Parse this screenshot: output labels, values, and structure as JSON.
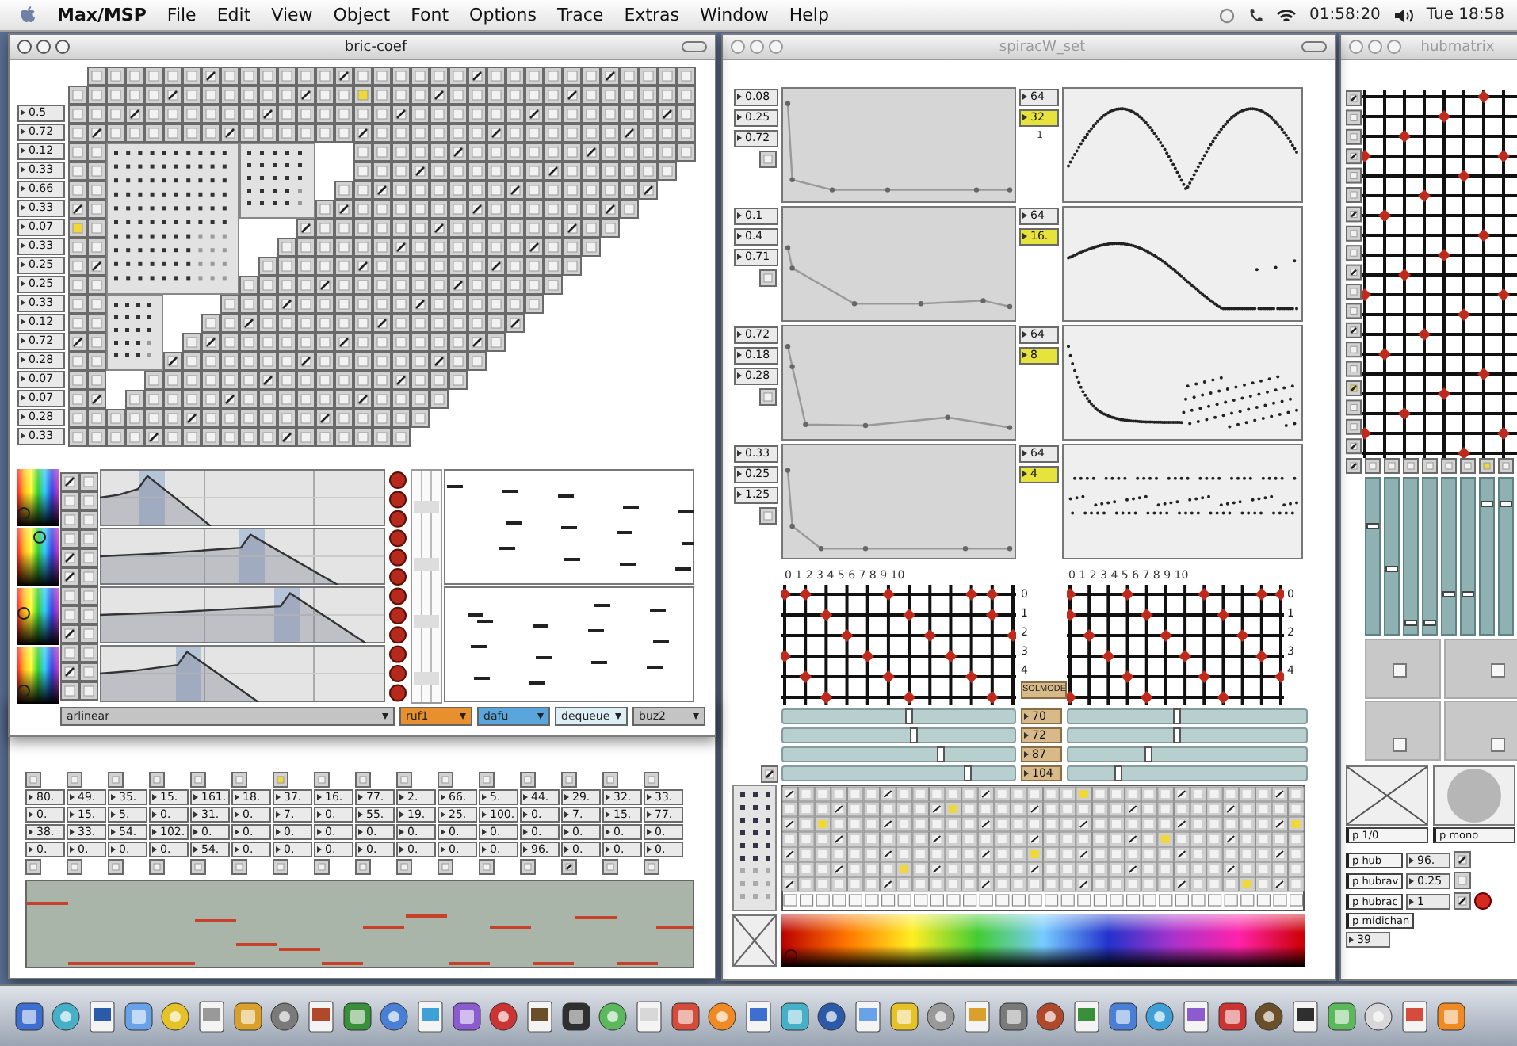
{
  "menubar": {
    "app": "Max/MSP",
    "menus": [
      "File",
      "Edit",
      "View",
      "Object",
      "Font",
      "Options",
      "Trace",
      "Extras",
      "Window",
      "Help"
    ],
    "clock": "01:58:20",
    "date": "Tue 18:58"
  },
  "bric": {
    "title": "bric-coef",
    "active": true,
    "coefficients": [
      "0.5",
      "0.72",
      "0.12",
      "0.33",
      "0.66",
      "0.33",
      "0.07",
      "0.33",
      "0.25",
      "0.25",
      "0.33",
      "0.12",
      "0.72",
      "0.28",
      "0.07",
      "0.07",
      "0.28",
      "0.33"
    ],
    "menus": [
      {
        "label": "arlinear",
        "color": "#c4c4c4"
      },
      {
        "label": "ruf1",
        "color": "#e8902e"
      },
      {
        "label": "dafu",
        "color": "#5aa6dc"
      },
      {
        "label": "dequeue",
        "color": "#ddeef5"
      },
      {
        "label": "buz2",
        "color": "#c4c4c4"
      }
    ]
  },
  "sequencer": {
    "columns": [
      {
        "values": [
          "80.",
          "0.",
          "38.",
          "0."
        ],
        "lit": false,
        "checked": false
      },
      {
        "values": [
          "49.",
          "15.",
          "33.",
          "0."
        ],
        "lit": false,
        "checked": false
      },
      {
        "values": [
          "35.",
          "5.",
          "54.",
          "0."
        ],
        "lit": false,
        "checked": false
      },
      {
        "values": [
          "15.",
          "0.",
          "102.",
          "0."
        ],
        "lit": false,
        "checked": false
      },
      {
        "values": [
          "161.",
          "31.",
          "0.",
          "54."
        ],
        "lit": false,
        "checked": false
      },
      {
        "values": [
          "18.",
          "0.",
          "0.",
          "0."
        ],
        "lit": false,
        "checked": false
      },
      {
        "values": [
          "37.",
          "7.",
          "0.",
          "0."
        ],
        "lit": true,
        "checked": false
      },
      {
        "values": [
          "16.",
          "0.",
          "0.",
          "0."
        ],
        "lit": false,
        "checked": false
      },
      {
        "values": [
          "77.",
          "55.",
          "0.",
          "0."
        ],
        "lit": false,
        "checked": false
      },
      {
        "values": [
          "2.",
          "19.",
          "0.",
          "0."
        ],
        "lit": false,
        "checked": false
      },
      {
        "values": [
          "66.",
          "25.",
          "0.",
          "0."
        ],
        "lit": false,
        "checked": false
      },
      {
        "values": [
          "5.",
          "100.",
          "0.",
          "0."
        ],
        "lit": false,
        "checked": false
      },
      {
        "values": [
          "44.",
          "0.",
          "0.",
          "96."
        ],
        "lit": false,
        "checked": false
      },
      {
        "values": [
          "29.",
          "7.",
          "0.",
          "0."
        ],
        "lit": false,
        "checked": true
      },
      {
        "values": [
          "32.",
          "15.",
          "0.",
          "0."
        ],
        "lit": false,
        "checked": false
      },
      {
        "values": [
          "33.",
          "77.",
          "0.",
          "0."
        ],
        "lit": false,
        "checked": false
      }
    ]
  },
  "spirac": {
    "title": "spiracW_set",
    "active": false,
    "plots": [
      {
        "values": [
          "0.08",
          "0.25",
          "0.72"
        ],
        "size": "64",
        "step": "32",
        "note": "1"
      },
      {
        "values": [
          "0.1",
          "0.4",
          "0.71"
        ],
        "size": "64",
        "step": "16."
      },
      {
        "values": [
          "0.72",
          "0.18",
          "0.28"
        ],
        "size": "64",
        "step": "8"
      },
      {
        "values": [
          "0.33",
          "0.25",
          "1.25"
        ],
        "size": "64",
        "step": "4"
      }
    ],
    "matrices": [
      {
        "columns": "0 1 2 3 4 5 6 7 8 9 10",
        "rows": [
          "0",
          "1",
          "2",
          "3",
          "4"
        ]
      },
      {
        "columns": "0 1 2 3 4 5 6 7 8 9 10",
        "rows": [
          "0",
          "1",
          "2",
          "3",
          "4"
        ]
      }
    ],
    "mode": "SOLMODE",
    "sliders": [
      {
        "reading": "70",
        "left": {
          "level": 0.54
        },
        "right": {
          "level": 0.45
        }
      },
      {
        "reading": "72",
        "left": {
          "level": 0.56
        },
        "right": {
          "level": 0.45
        }
      },
      {
        "reading": "87",
        "left": {
          "level": 0.68
        },
        "right": {
          "level": 0.33
        }
      },
      {
        "reading": "104",
        "left": {
          "level": 0.8
        },
        "right": {
          "level": 0.2
        }
      }
    ],
    "sync_toggle": {
      "checked": true
    }
  },
  "hub": {
    "title": "hubmatrix",
    "active": false,
    "faders": [
      {
        "level": 0.7
      },
      {
        "level": 0.42
      },
      {
        "level": 0.05
      },
      {
        "level": 0.05
      },
      {
        "level": 0.25
      },
      {
        "level": 0.25
      },
      {
        "level": 0.85
      },
      {
        "level": 0.85
      }
    ],
    "pads": [
      "p 1/0",
      "p mono"
    ],
    "params": [
      {
        "name": "p hub",
        "value": "96.",
        "checked": true,
        "lamp": false
      },
      {
        "name": "p hubrav",
        "value": "0.25",
        "checked": false,
        "lamp": false
      },
      {
        "name": "p hubrac",
        "value": "1",
        "checked": true,
        "lamp": true
      }
    ],
    "midi": {
      "name": "p midichan",
      "value": "39"
    }
  }
}
